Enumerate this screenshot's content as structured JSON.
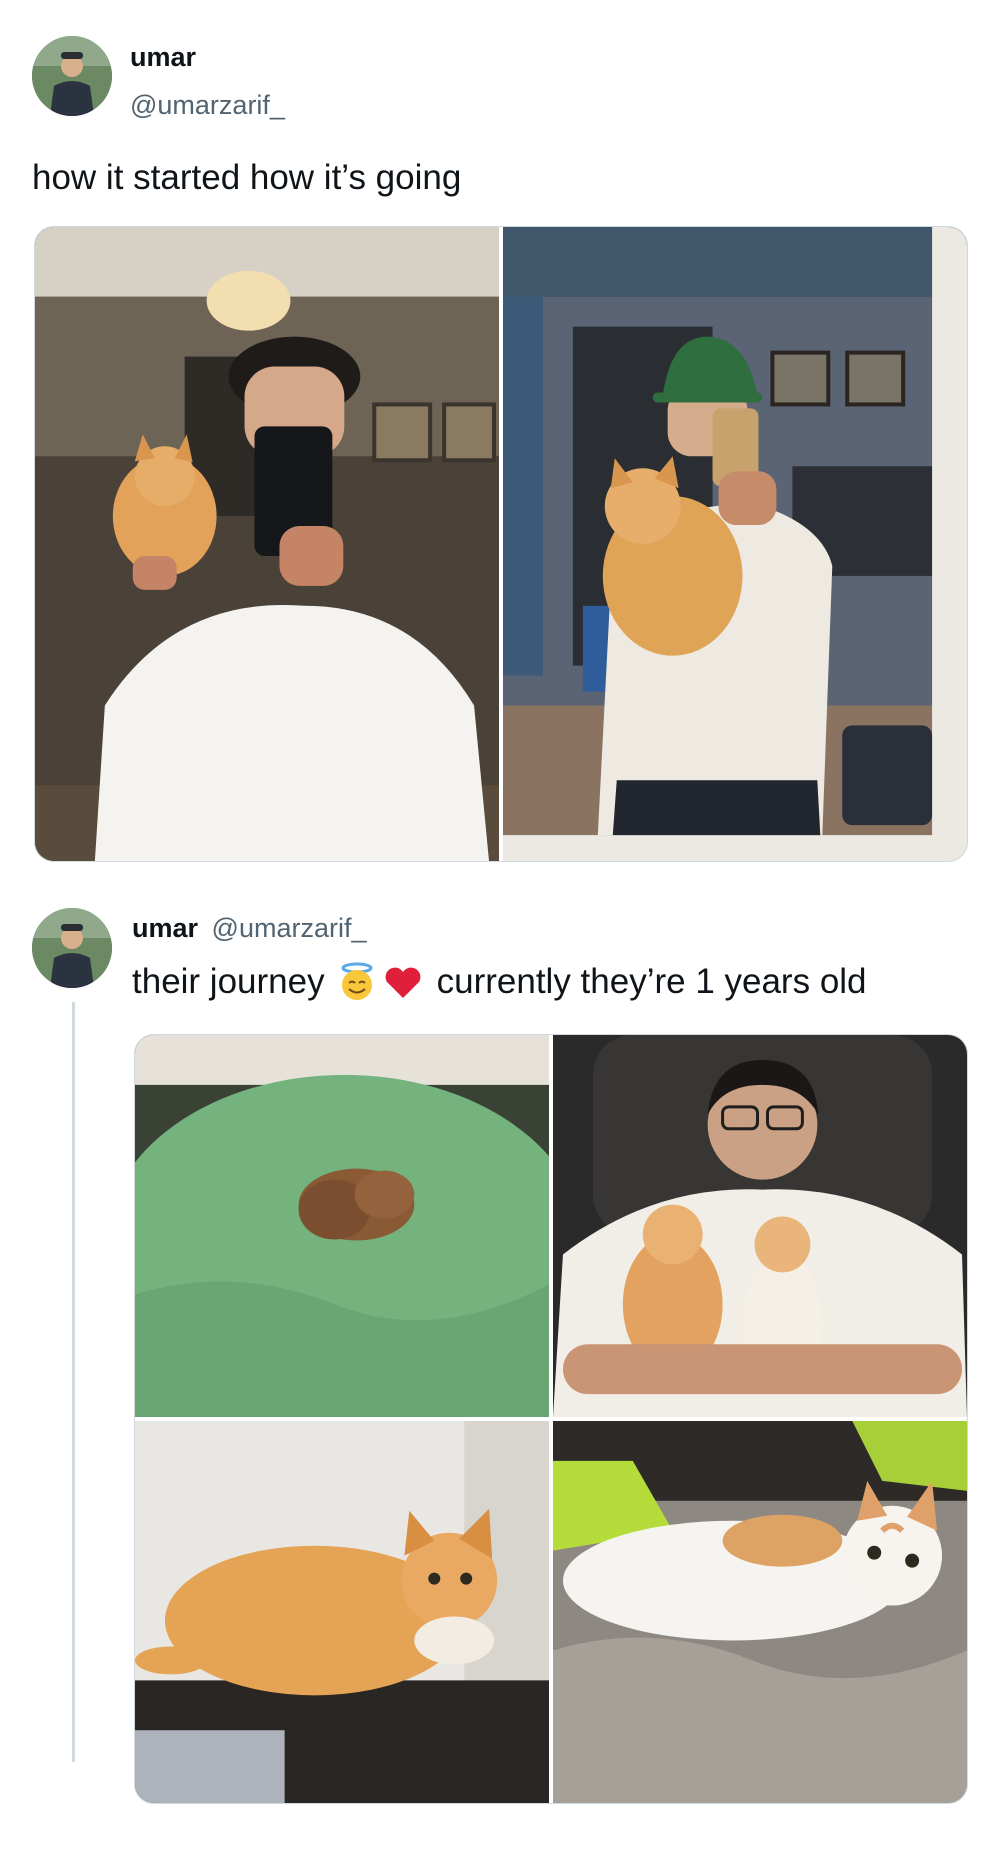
{
  "tweet1": {
    "author_name": "umar",
    "author_handle": "@umarzarif_",
    "text": "how it started how it’s going",
    "photos": [
      {
        "subject": "mirror-selfie-holding-kitten"
      },
      {
        "subject": "mirror-selfie-holding-grown-cat"
      }
    ]
  },
  "tweet2": {
    "author_name": "umar",
    "author_handle": "@umarzarif_",
    "text_before_emoji": "their journey",
    "emojis": [
      "smiling-face-with-halo",
      "red-heart"
    ],
    "text_after_emoji": "currently they’re 1 years old",
    "photos": [
      {
        "subject": "newborn-kittens-on-green-blanket"
      },
      {
        "subject": "man-holding-two-kittens"
      },
      {
        "subject": "orange-cat-lying-on-table"
      },
      {
        "subject": "white-orange-cat-on-blanket"
      }
    ]
  },
  "colors": {
    "text": "#0f1419",
    "secondary_text": "#536471",
    "border": "#cfd9de",
    "thread_line": "#cfd9de"
  }
}
